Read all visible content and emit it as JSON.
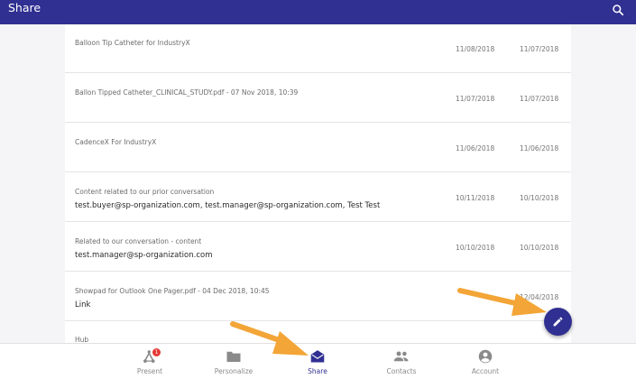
{
  "header": {
    "title": "Share",
    "search_icon": "search-icon"
  },
  "rows": [
    {
      "title": "Balloon Tip Catheter for IndustryX",
      "subtitle": "",
      "date1": "11/08/2018",
      "date2": "11/07/2018"
    },
    {
      "title": "Ballon Tipped Catheter_CLINICAL_STUDY.pdf - 07 Nov 2018, 10:39",
      "subtitle": "",
      "date1": "11/07/2018",
      "date2": "11/07/2018"
    },
    {
      "title": "CadenceX For IndustryX",
      "subtitle": "",
      "date1": "11/06/2018",
      "date2": "11/06/2018"
    },
    {
      "title": "Content related to our prior conversation",
      "subtitle": "test.buyer@sp-organization.com, test.manager@sp-organization.com, Test Test",
      "date1": "10/11/2018",
      "date2": "10/10/2018"
    },
    {
      "title": "Related to our conversation - content",
      "subtitle": "test.manager@sp-organization.com",
      "date1": "10/10/2018",
      "date2": "10/10/2018"
    },
    {
      "title": "Showpad for Outlook One Pager.pdf - 04 Dec 2018, 10:45",
      "subtitle": "Link",
      "date1": "",
      "date2": "12/04/2018"
    },
    {
      "title": "Hub",
      "subtitle": "",
      "date1": "",
      "date2": ""
    }
  ],
  "nav": {
    "items": [
      {
        "label": "Present",
        "icon": "present-icon",
        "badge": "1"
      },
      {
        "label": "Personalize",
        "icon": "folder-icon"
      },
      {
        "label": "Share",
        "icon": "envelope-icon",
        "active": true
      },
      {
        "label": "Contacts",
        "icon": "contacts-icon"
      },
      {
        "label": "Account",
        "icon": "account-icon"
      }
    ]
  },
  "fab": {
    "icon": "pencil-icon"
  },
  "colors": {
    "primary": "#303092",
    "arrow": "#f3a537",
    "badge": "#e53935"
  }
}
